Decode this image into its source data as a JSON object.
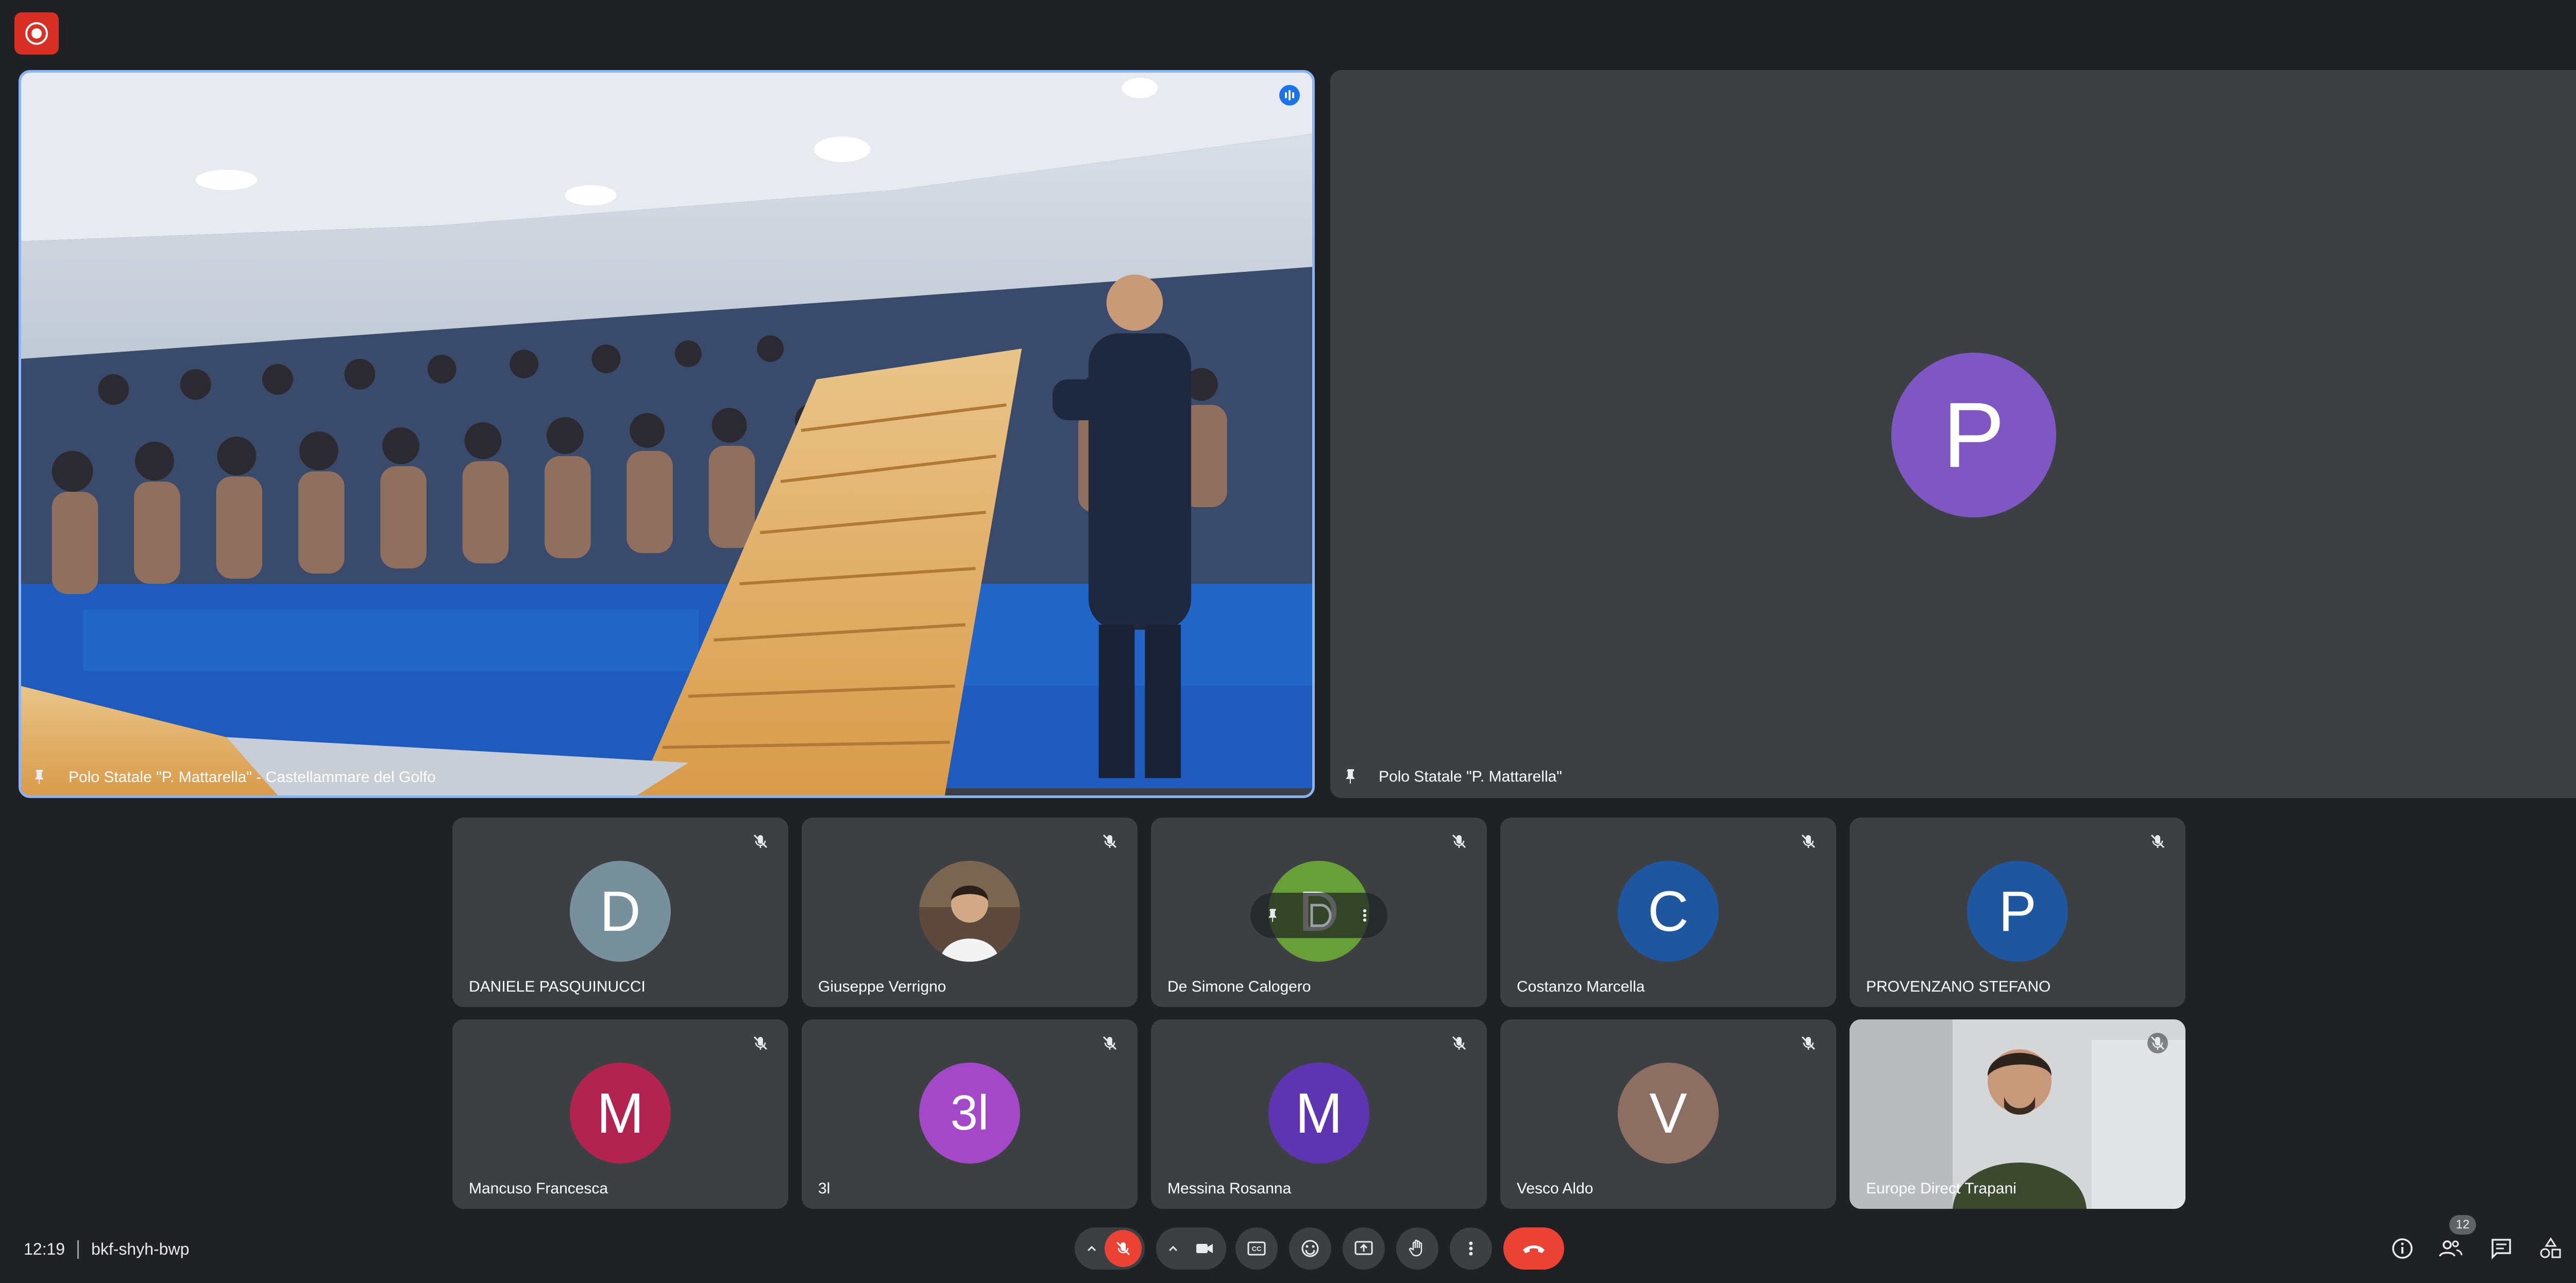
{
  "meeting": {
    "time": "12:19",
    "code": "bkf-shyh-bwp",
    "participant_count": "12"
  },
  "main_tiles": [
    {
      "name": "Polo Statale \"P. Mattarella\" - Castellammare del Golfo"
    },
    {
      "name": "Polo Statale \"P. Mattarella\"",
      "initial": "P",
      "avatar_color": "#7e57c2"
    }
  ],
  "participants": [
    {
      "name": "DANIELE PASQUINUCCI",
      "initial": "D",
      "color": "#78909c"
    },
    {
      "name": "Giuseppe Verrigno",
      "initial": "",
      "color": "#6d4c41"
    },
    {
      "name": "De Simone Calogero",
      "initial": "D",
      "color": "#689f38"
    },
    {
      "name": "Costanzo Marcella",
      "initial": "C",
      "color": "#1e56a0"
    },
    {
      "name": "PROVENZANO STEFANO",
      "initial": "P",
      "color": "#1e56a0"
    },
    {
      "name": "Mancuso Francesca",
      "initial": "M",
      "color": "#b0244f"
    },
    {
      "name": "3l",
      "initial": "3l",
      "color": "#a349c8"
    },
    {
      "name": "Messina Rosanna",
      "initial": "M",
      "color": "#5e35b1"
    },
    {
      "name": "Vesco Aldo",
      "initial": "V",
      "color": "#8d6e63"
    },
    {
      "name": "Europe Direct Trapani",
      "initial": "",
      "color": "#c7c9cc"
    }
  ],
  "colors": {
    "background": "#202124",
    "tile": "#3c4043",
    "record_red": "#d93025",
    "end_call_red": "#d93025",
    "active_speaker_border": "#8ab4f8"
  },
  "icons": {
    "record": "record-icon",
    "mic_off": "mic-off-icon",
    "camera": "camera-icon",
    "captions": "captions-icon",
    "emoji": "emoji-icon",
    "present": "present-icon",
    "raise_hand": "raise-hand-icon",
    "more": "more-vert-icon",
    "end_call": "end-call-icon",
    "info": "info-icon",
    "people": "people-icon",
    "chat": "chat-icon",
    "activities": "activities-icon",
    "host_controls": "lock-icon"
  }
}
